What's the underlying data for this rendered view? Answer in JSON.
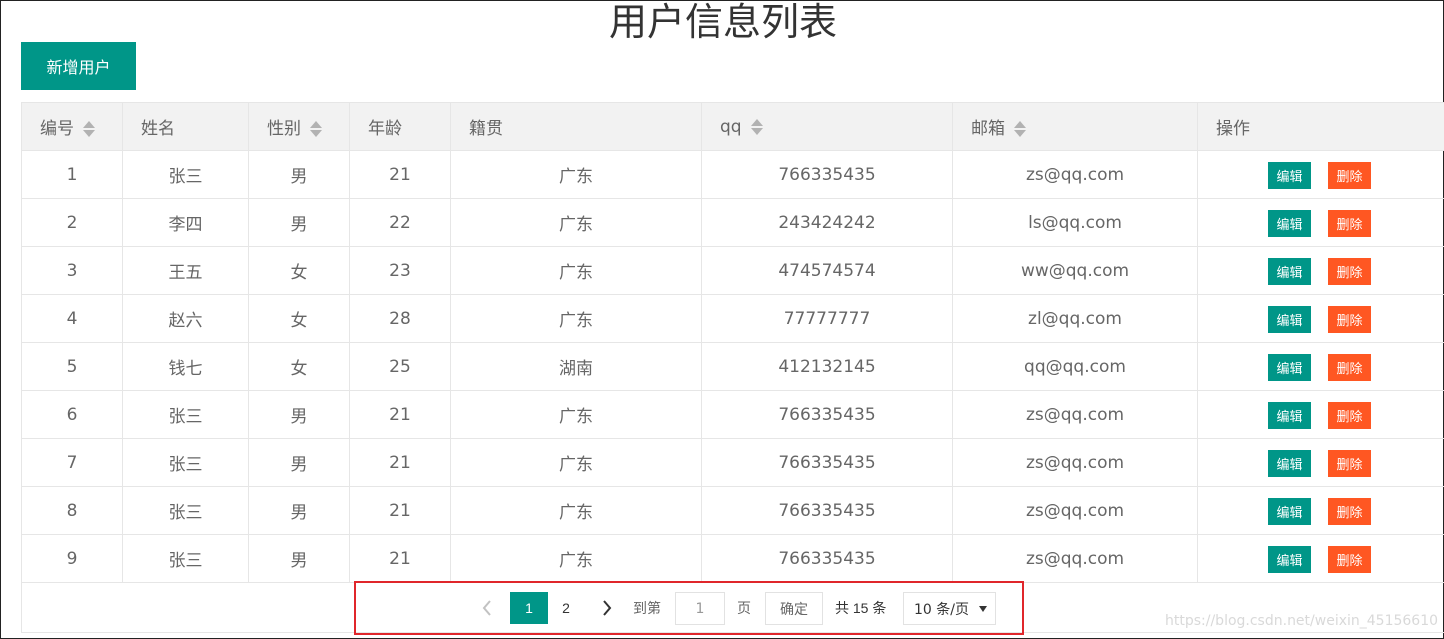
{
  "page_title": "用户信息列表",
  "add_button_label": "新增用户",
  "columns": [
    {
      "label": "编号",
      "sortable": true
    },
    {
      "label": "姓名",
      "sortable": false
    },
    {
      "label": "性别",
      "sortable": true
    },
    {
      "label": "年龄",
      "sortable": false
    },
    {
      "label": "籍贯",
      "sortable": false
    },
    {
      "label": "qq",
      "sortable": true
    },
    {
      "label": "邮箱",
      "sortable": true
    },
    {
      "label": "操作",
      "sortable": false
    }
  ],
  "rows": [
    {
      "id": "1",
      "name": "张三",
      "gender": "男",
      "age": "21",
      "origin": "广东",
      "qq": "766335435",
      "email": "zs@qq.com"
    },
    {
      "id": "2",
      "name": "李四",
      "gender": "男",
      "age": "22",
      "origin": "广东",
      "qq": "243424242",
      "email": "ls@qq.com"
    },
    {
      "id": "3",
      "name": "王五",
      "gender": "女",
      "age": "23",
      "origin": "广东",
      "qq": "474574574",
      "email": "ww@qq.com"
    },
    {
      "id": "4",
      "name": "赵六",
      "gender": "女",
      "age": "28",
      "origin": "广东",
      "qq": "77777777",
      "email": "zl@qq.com"
    },
    {
      "id": "5",
      "name": "钱七",
      "gender": "女",
      "age": "25",
      "origin": "湖南",
      "qq": "412132145",
      "email": "qq@qq.com"
    },
    {
      "id": "6",
      "name": "张三",
      "gender": "男",
      "age": "21",
      "origin": "广东",
      "qq": "766335435",
      "email": "zs@qq.com"
    },
    {
      "id": "7",
      "name": "张三",
      "gender": "男",
      "age": "21",
      "origin": "广东",
      "qq": "766335435",
      "email": "zs@qq.com"
    },
    {
      "id": "8",
      "name": "张三",
      "gender": "男",
      "age": "21",
      "origin": "广东",
      "qq": "766335435",
      "email": "zs@qq.com"
    },
    {
      "id": "9",
      "name": "张三",
      "gender": "男",
      "age": "21",
      "origin": "广东",
      "qq": "766335435",
      "email": "zs@qq.com"
    }
  ],
  "row_actions": {
    "edit_label": "编辑",
    "delete_label": "删除"
  },
  "pager": {
    "prev_icon": "chevron-left-icon",
    "next_icon": "chevron-right-icon",
    "pages": [
      "1",
      "2"
    ],
    "current_page": "1",
    "goto_label": "到第",
    "goto_value": "1",
    "page_label": "页",
    "confirm_label": "确定",
    "total_label": "共 15 条",
    "page_size_label": "10 条/页"
  },
  "watermark": "https://blog.csdn.net/weixin_45156610",
  "colors": {
    "primary": "#009688",
    "danger": "#ff5722",
    "highlight_border": "#e0262b",
    "header_bg": "#f2f2f2"
  }
}
